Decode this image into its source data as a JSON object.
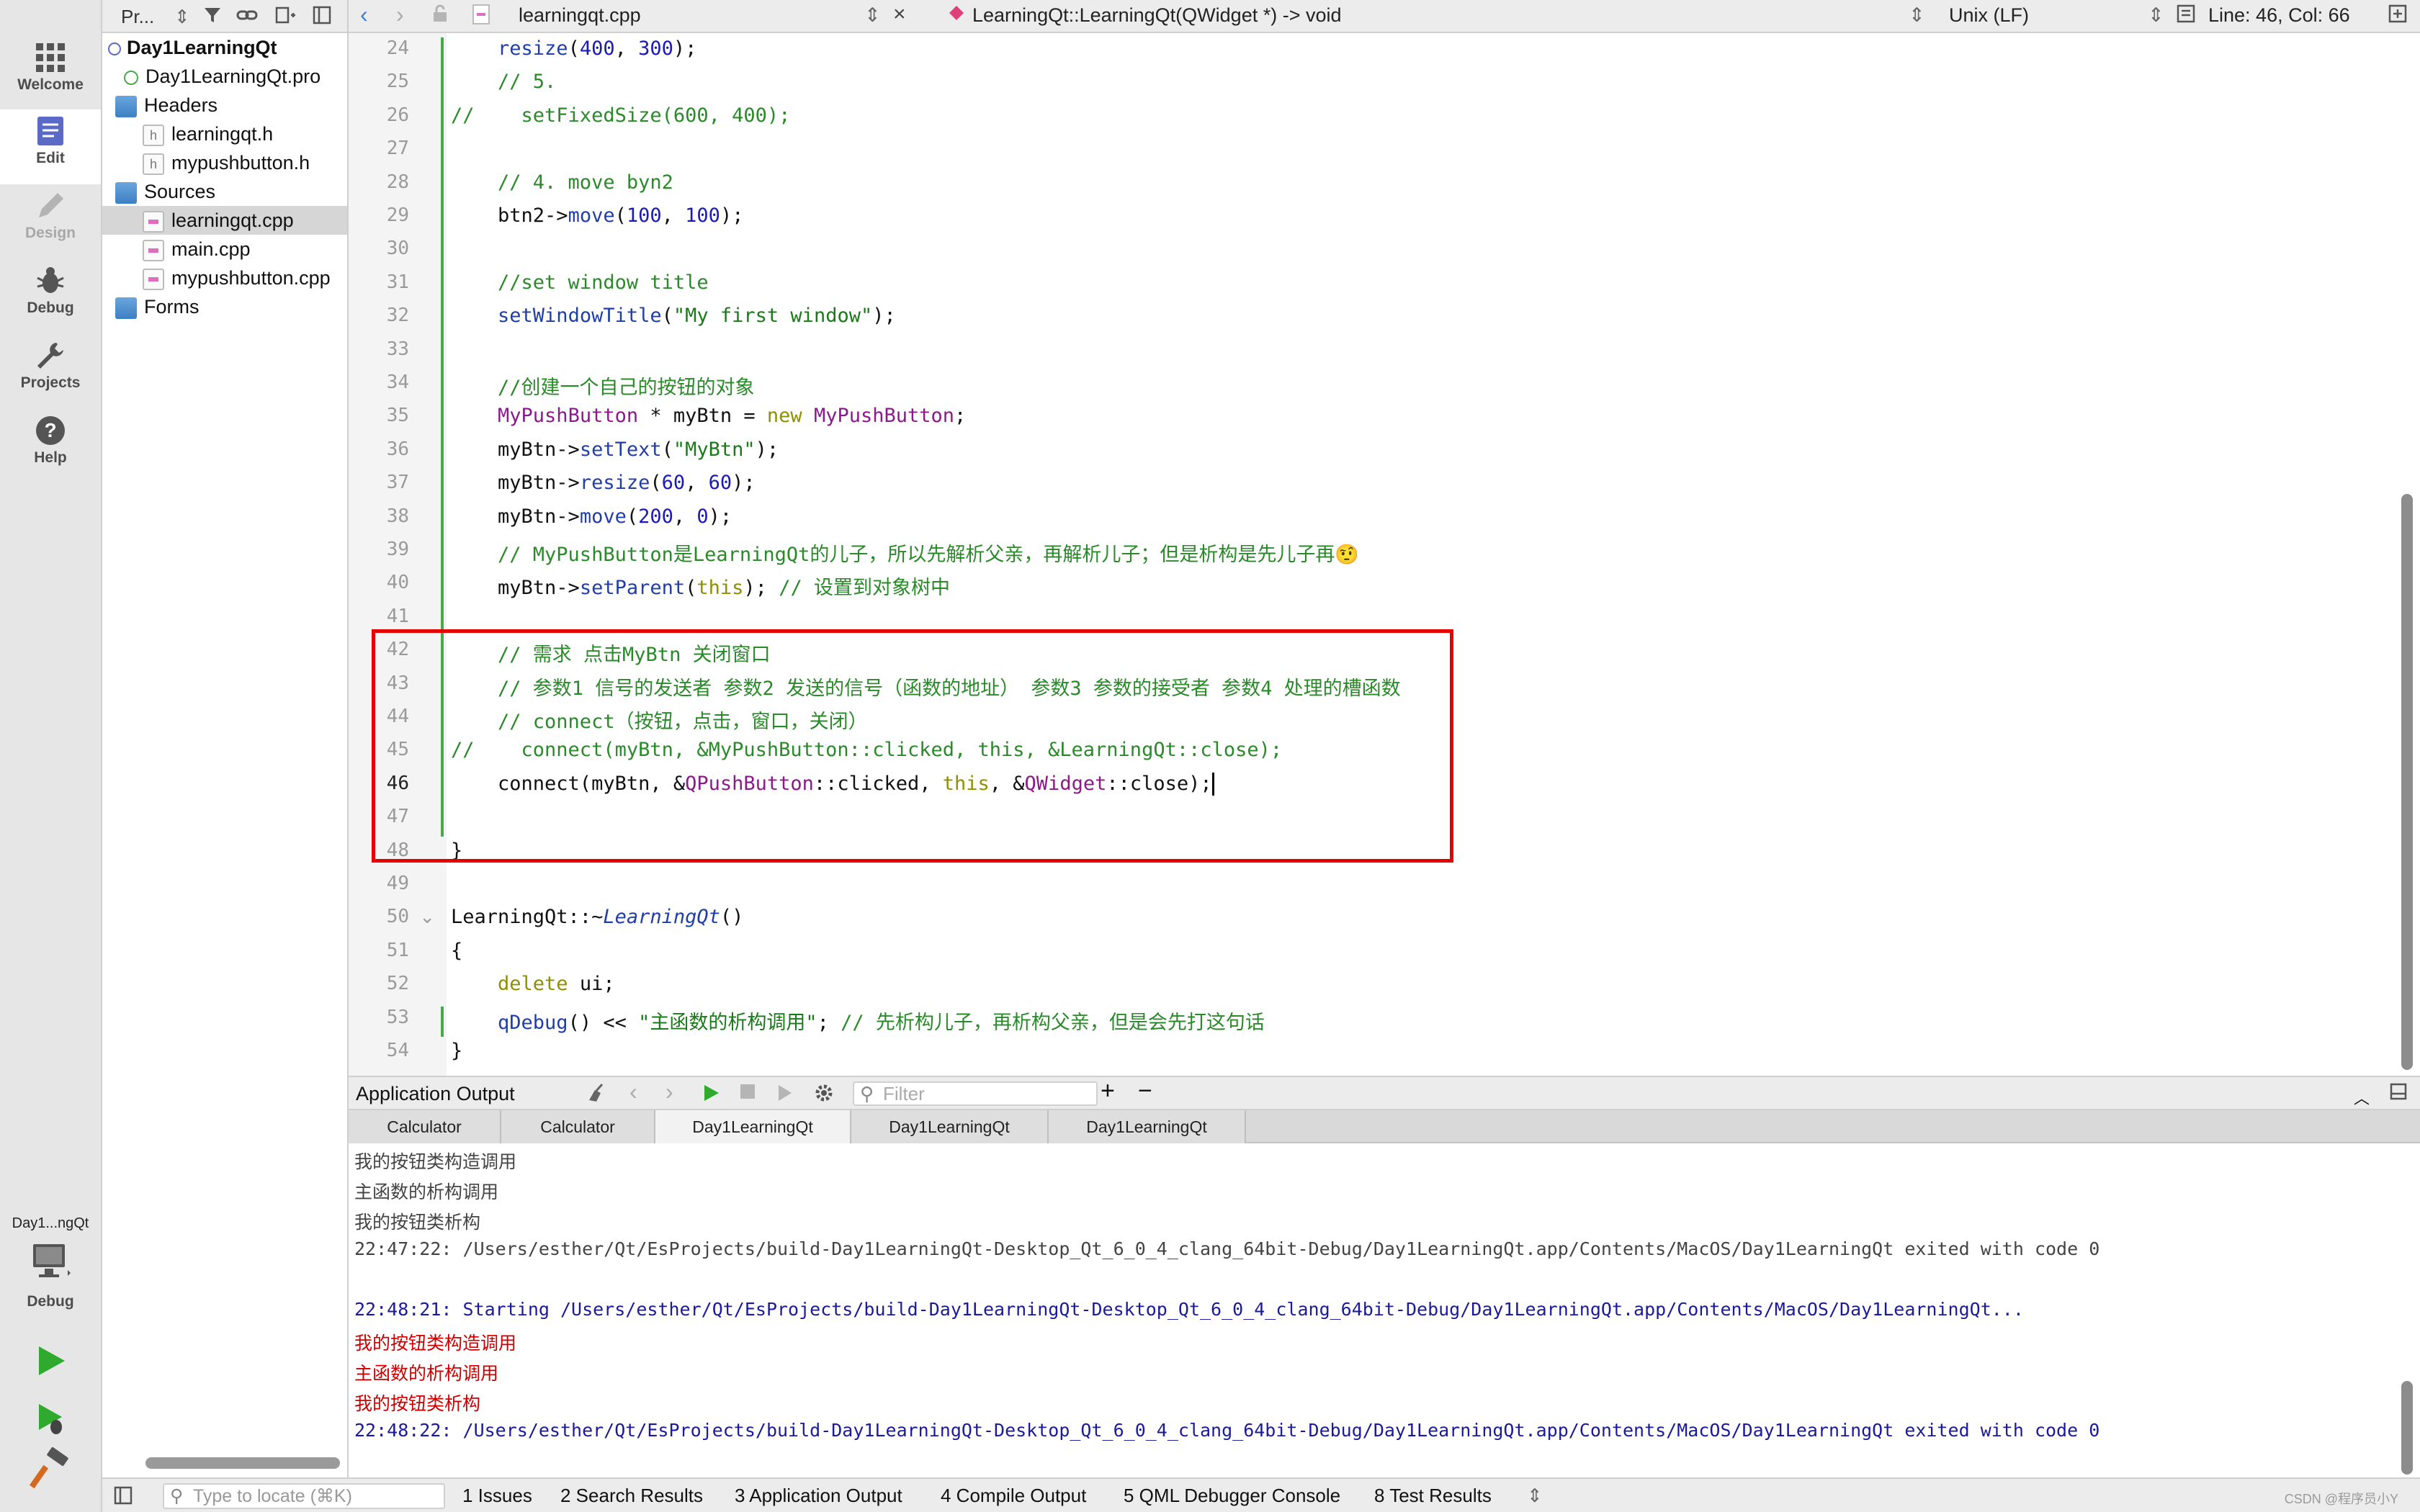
{
  "modebar": {
    "modes": [
      {
        "label": "Welcome",
        "icon": "grid-icon"
      },
      {
        "label": "Edit",
        "icon": "document-icon"
      },
      {
        "label": "Design",
        "icon": "pencil-icon"
      },
      {
        "label": "Debug",
        "icon": "bug-icon"
      },
      {
        "label": "Projects",
        "icon": "wrench-icon"
      },
      {
        "label": "Help",
        "icon": "help-icon"
      }
    ],
    "kit_name": "Day1...ngQt",
    "kit_mode": "Debug"
  },
  "project_panel": {
    "selector_label": "Pr...",
    "tree": [
      {
        "label": "Day1LearningQt",
        "kind": "project"
      },
      {
        "label": "Day1LearningQt.pro",
        "kind": "pro"
      },
      {
        "label": "Headers",
        "kind": "folder"
      },
      {
        "label": "learningqt.h",
        "kind": "header"
      },
      {
        "label": "mypushbutton.h",
        "kind": "header"
      },
      {
        "label": "Sources",
        "kind": "folder"
      },
      {
        "label": "learningqt.cpp",
        "kind": "source"
      },
      {
        "label": "main.cpp",
        "kind": "source"
      },
      {
        "label": "mypushbutton.cpp",
        "kind": "source"
      },
      {
        "label": "Forms",
        "kind": "folder"
      }
    ],
    "selected": "learningqt.cpp"
  },
  "editor_toolbar": {
    "file_name": "learningqt.cpp",
    "symbol": "LearningQt::LearningQt(QWidget *) -> void",
    "line_ending": "Unix (LF)",
    "position": "Line: 46, Col: 66"
  },
  "editor": {
    "line_numbers": [
      "24",
      "25",
      "26",
      "27",
      "28",
      "29",
      "30",
      "31",
      "32",
      "33",
      "34",
      "35",
      "36",
      "37",
      "38",
      "39",
      "40",
      "41",
      "42",
      "43",
      "44",
      "45",
      "46",
      "47",
      "48",
      "49",
      "50",
      "51",
      "52",
      "53",
      "54"
    ],
    "current_line": "46",
    "lines": [
      "    resize(400, 300);",
      "    // 5.",
      "//    setFixedSize(600, 400);",
      "",
      "    // 4. move byn2",
      "    btn2->move(100, 100);",
      "",
      "    //set window title",
      "    setWindowTitle(\"My first window\");",
      "",
      "    //创建一个自己的按钮的对象",
      "    MyPushButton * myBtn = new MyPushButton;",
      "    myBtn->setText(\"MyBtn\");",
      "    myBtn->resize(60, 60);",
      "    myBtn->move(200, 0);",
      "    // MyPushButton是LearningQt的儿子，所以先解析父亲，再解析儿子；但是析构是先儿子再🤨",
      "    myBtn->setParent(this); // 设置到对象树中",
      "",
      "    // 需求 点击MyBtn 关闭窗口",
      "    // 参数1 信号的发送者 参数2 发送的信号（函数的地址） 参数3 参数的接受者 参数4 处理的槽函数",
      "    // connect（按钮，点击，窗口，关闭）",
      "//    connect(myBtn, &MyPushButton::clicked, this, &LearningQt::close);",
      "    connect(myBtn, &QPushButton::clicked, this, &QWidget::close);",
      "",
      "}",
      "",
      "LearningQt::~LearningQt()",
      "{",
      "    delete ui;",
      "    qDebug() << \"主函数的析构调用\"; // 先析构儿子，再析构父亲，但是会先打这句话",
      "}"
    ]
  },
  "output": {
    "title": "Application Output",
    "filter_placeholder": "Filter",
    "tabs": [
      "Calculator",
      "Calculator",
      "Day1LearningQt",
      "Day1LearningQt",
      "Day1LearningQt"
    ],
    "active_tab": 2,
    "lines": [
      {
        "text": "我的按钮类构造调用",
        "style": "gray"
      },
      {
        "text": "主函数的析构调用",
        "style": "gray"
      },
      {
        "text": "我的按钮类析构",
        "style": "gray"
      },
      {
        "text": "22:47:22: /Users/esther/Qt/EsProjects/build-Day1LearningQt-Desktop_Qt_6_0_4_clang_64bit-Debug/Day1LearningQt.app/Contents/MacOS/Day1LearningQt exited with code 0",
        "style": "gray"
      },
      {
        "text": "",
        "style": "gray"
      },
      {
        "text": "22:48:21: Starting /Users/esther/Qt/EsProjects/build-Day1LearningQt-Desktop_Qt_6_0_4_clang_64bit-Debug/Day1LearningQt.app/Contents/MacOS/Day1LearningQt...",
        "style": "blue"
      },
      {
        "text": "我的按钮类构造调用",
        "style": "red"
      },
      {
        "text": "主函数的析构调用",
        "style": "red"
      },
      {
        "text": "我的按钮类析构",
        "style": "red"
      },
      {
        "text": "22:48:22: /Users/esther/Qt/EsProjects/build-Day1LearningQt-Desktop_Qt_6_0_4_clang_64bit-Debug/Day1LearningQt.app/Contents/MacOS/Day1LearningQt exited with code 0",
        "style": "blue"
      }
    ]
  },
  "statusbar": {
    "locate_placeholder": "Type to locate (⌘K)",
    "tabs": [
      "1  Issues",
      "2  Search Results",
      "3  Application Output",
      "4  Compile Output",
      "5  QML Debugger Console",
      "8  Test Results"
    ],
    "watermark": "CSDN @程序员小Y"
  },
  "colors": {
    "highlight_box": "#e60000",
    "comment": "#2a8a2a",
    "number": "#1a1ab4",
    "change_marker": "#4aa84a"
  }
}
